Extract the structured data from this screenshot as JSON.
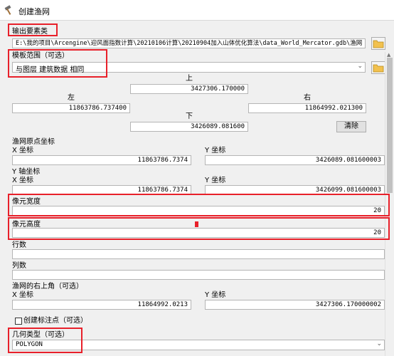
{
  "window": {
    "title": "创建渔网"
  },
  "output_features": {
    "label": "输出要素类",
    "value": "E:\\我的项目\\Arcengine\\迎风面指数计算\\20210106计算\\20210904加入山体优化算法\\data_World_Mercator.gdb\\渔网"
  },
  "template_extent": {
    "label": "模板范围（可选）",
    "value": "与图层 建筑数据 相同"
  },
  "extent": {
    "top_label": "上",
    "top_value": "3427306.170000",
    "left_label": "左",
    "left_value": "11863786.737400",
    "right_label": "右",
    "right_value": "11864992.021300",
    "bottom_label": "下",
    "bottom_value": "3426089.081600",
    "clear_label": "清除"
  },
  "origin": {
    "label": "渔网原点坐标",
    "x_label": "X 坐标",
    "x_value": "11863786.7374",
    "y_label": "Y 坐标",
    "y_value": "3426089.081600003"
  },
  "y_axis": {
    "label": "Y 轴坐标",
    "x_label": "X 坐标",
    "x_value": "11863786.7374",
    "y_label": "Y 坐标",
    "y_value": "3426099.081600003"
  },
  "cell_width": {
    "label": "像元宽度",
    "value": "20"
  },
  "cell_height": {
    "label": "像元高度",
    "value": "20"
  },
  "rows": {
    "label": "行数",
    "value": ""
  },
  "columns": {
    "label": "列数",
    "value": ""
  },
  "opposite_corner": {
    "label": "渔网的右上角（可选）",
    "x_label": "X 坐标",
    "x_value": "11864992.0213",
    "y_label": "Y 坐标",
    "y_value": "3427306.170000002"
  },
  "label_points": {
    "label": "创建标注点（可选）",
    "checked": false
  },
  "geometry_type": {
    "label": "几何类型（可选）",
    "value": "POLYGON"
  },
  "colors": {
    "highlight": "#e8202a"
  },
  "icons": {
    "title": "hammer-icon",
    "folder": "folder-icon",
    "dropdown": "chevron-down-icon"
  }
}
